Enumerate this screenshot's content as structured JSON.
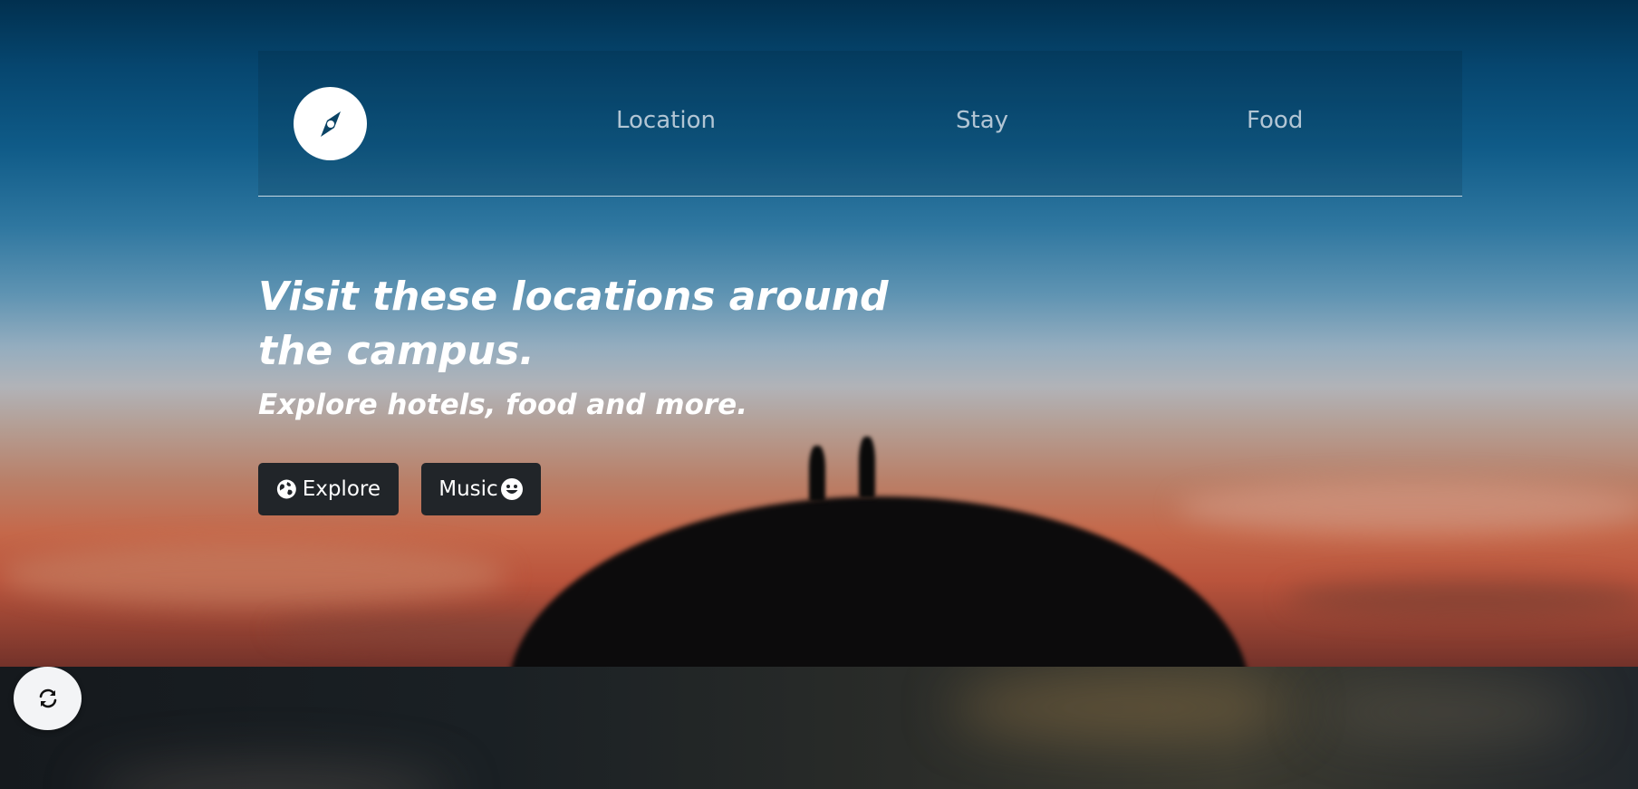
{
  "nav": {
    "brand_icon": "compass-icon",
    "links": [
      {
        "label": "Location"
      },
      {
        "label": "Stay"
      },
      {
        "label": "Food"
      }
    ]
  },
  "hero": {
    "headline": "Visit these locations around the campus.",
    "subheadline": "Explore hotels, food and more.",
    "buttons": {
      "explore": {
        "label": "Explore",
        "icon": "globe-icon"
      },
      "music": {
        "label": "Music",
        "icon": "smile-icon"
      }
    }
  },
  "floating": {
    "icon": "refresh-icon"
  },
  "colors": {
    "button_bg": "#212529",
    "brand_bg": "#ffffff",
    "brand_icon": "#0b4466",
    "nav_text": "#e1e8f0"
  }
}
